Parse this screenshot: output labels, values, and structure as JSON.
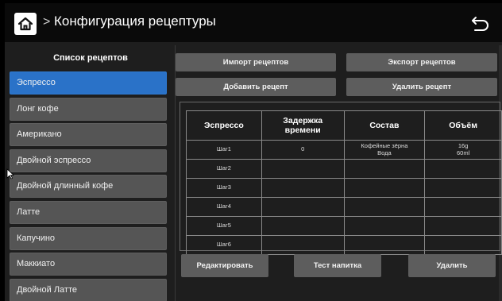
{
  "header": {
    "title": "Конфигурация рецептуры",
    "crumb_separator": ">",
    "home_icon": "home-icon",
    "back_icon": "undo-arrow-icon"
  },
  "sidebar": {
    "title": "Список рецептов",
    "items": [
      {
        "label": "Эспрессо",
        "active": true
      },
      {
        "label": "Лонг кофе"
      },
      {
        "label": "Американо"
      },
      {
        "label": "Двойной эспрессо"
      },
      {
        "label": "Двойной длинный кофе"
      },
      {
        "label": "Латте"
      },
      {
        "label": "Капучино"
      },
      {
        "label": "Маккиато"
      },
      {
        "label": "Двойной Латте"
      }
    ]
  },
  "actions": {
    "import": "Импорт рецептов",
    "export": "Экспорт рецептов",
    "add": "Добавить рецепт",
    "delete": "Удалить рецепт"
  },
  "table": {
    "headers": [
      "Эспрессо",
      "Задержка\nвремени",
      "Состав",
      "Объём"
    ],
    "rows": [
      [
        "Шаг1",
        "0",
        "Кофейные зёрна\nВода",
        "16g\n60ml"
      ],
      [
        "Шаг2",
        "",
        "",
        ""
      ],
      [
        "Шаг3",
        "",
        "",
        ""
      ],
      [
        "Шаг4",
        "",
        "",
        ""
      ],
      [
        "Шаг5",
        "",
        "",
        ""
      ],
      [
        "Шаг6",
        "",
        "",
        ""
      ]
    ]
  },
  "bottom": {
    "edit": "Редактировать",
    "test": "Тест напитка",
    "delete": "Удалить"
  },
  "colors": {
    "accent": "#2a72c8",
    "button": "#5d5d5d",
    "background": "#1e1e1e"
  }
}
